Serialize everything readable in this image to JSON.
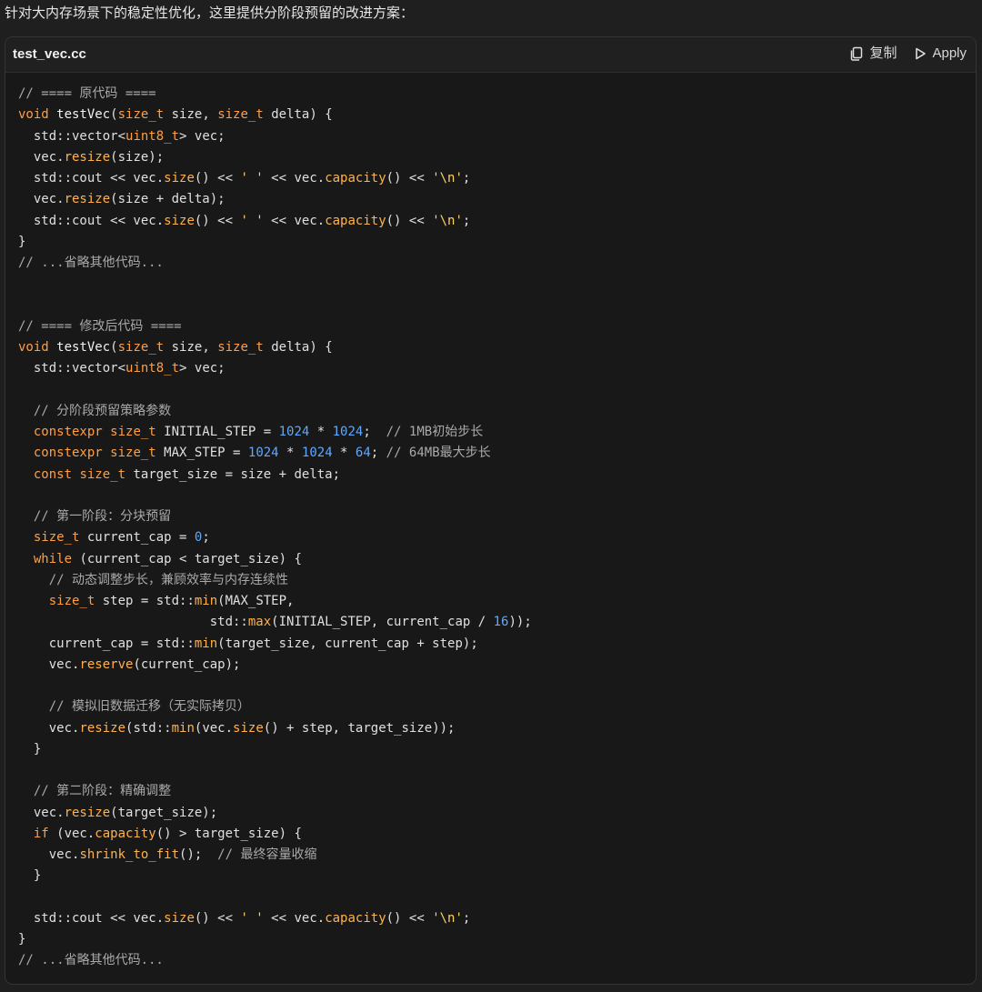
{
  "intro_text": "针对大内存场景下的稳定性优化，这里提供分阶段预留的改进方案：",
  "header": {
    "file_name": "test_vec.cc",
    "copy_label": "复制",
    "apply_label": "Apply"
  },
  "colors": {
    "background": "#1f1f1f",
    "code_background": "#181818",
    "keyword": "#ff9f43",
    "method": "#ffb24d",
    "number": "#5fa8ff",
    "string": "#ffd45c",
    "comment": "#a9a9a9",
    "text": "#e0e0e0"
  },
  "code": {
    "lines": [
      [
        {
          "t": "comment",
          "v": "// ==== 原代码 ===="
        }
      ],
      [
        {
          "t": "keyword",
          "v": "void"
        },
        {
          "t": "plain",
          "v": " "
        },
        {
          "t": "func",
          "v": "testVec"
        },
        {
          "t": "plain",
          "v": "("
        },
        {
          "t": "type",
          "v": "size_t"
        },
        {
          "t": "plain",
          "v": " size, "
        },
        {
          "t": "type",
          "v": "size_t"
        },
        {
          "t": "plain",
          "v": " delta) {"
        }
      ],
      [
        {
          "t": "plain",
          "v": "  std::vector<"
        },
        {
          "t": "type",
          "v": "uint8_t"
        },
        {
          "t": "plain",
          "v": "> vec;"
        }
      ],
      [
        {
          "t": "plain",
          "v": "  vec."
        },
        {
          "t": "method",
          "v": "resize"
        },
        {
          "t": "plain",
          "v": "(size);"
        }
      ],
      [
        {
          "t": "plain",
          "v": "  std::cout << vec."
        },
        {
          "t": "method",
          "v": "size"
        },
        {
          "t": "plain",
          "v": "() << "
        },
        {
          "t": "string",
          "v": "' '"
        },
        {
          "t": "plain",
          "v": " << vec."
        },
        {
          "t": "method",
          "v": "capacity"
        },
        {
          "t": "plain",
          "v": "() << "
        },
        {
          "t": "string",
          "v": "'\\n'"
        },
        {
          "t": "plain",
          "v": ";"
        }
      ],
      [
        {
          "t": "plain",
          "v": "  vec."
        },
        {
          "t": "method",
          "v": "resize"
        },
        {
          "t": "plain",
          "v": "(size + delta);"
        }
      ],
      [
        {
          "t": "plain",
          "v": "  std::cout << vec."
        },
        {
          "t": "method",
          "v": "size"
        },
        {
          "t": "plain",
          "v": "() << "
        },
        {
          "t": "string",
          "v": "' '"
        },
        {
          "t": "plain",
          "v": " << vec."
        },
        {
          "t": "method",
          "v": "capacity"
        },
        {
          "t": "plain",
          "v": "() << "
        },
        {
          "t": "string",
          "v": "'\\n'"
        },
        {
          "t": "plain",
          "v": ";"
        }
      ],
      [
        {
          "t": "plain",
          "v": "}"
        }
      ],
      [
        {
          "t": "comment",
          "v": "// ...省略其他代码..."
        }
      ],
      [],
      [],
      [
        {
          "t": "comment",
          "v": "// ==== 修改后代码 ===="
        }
      ],
      [
        {
          "t": "keyword",
          "v": "void"
        },
        {
          "t": "plain",
          "v": " "
        },
        {
          "t": "func",
          "v": "testVec"
        },
        {
          "t": "plain",
          "v": "("
        },
        {
          "t": "type",
          "v": "size_t"
        },
        {
          "t": "plain",
          "v": " size, "
        },
        {
          "t": "type",
          "v": "size_t"
        },
        {
          "t": "plain",
          "v": " delta) {"
        }
      ],
      [
        {
          "t": "plain",
          "v": "  std::vector<"
        },
        {
          "t": "type",
          "v": "uint8_t"
        },
        {
          "t": "plain",
          "v": "> vec;"
        }
      ],
      [],
      [
        {
          "t": "comment",
          "v": "  // 分阶段预留策略参数"
        }
      ],
      [
        {
          "t": "keyword",
          "v": "  constexpr"
        },
        {
          "t": "plain",
          "v": " "
        },
        {
          "t": "type",
          "v": "size_t"
        },
        {
          "t": "plain",
          "v": " INITIAL_STEP = "
        },
        {
          "t": "number",
          "v": "1024"
        },
        {
          "t": "plain",
          "v": " * "
        },
        {
          "t": "number",
          "v": "1024"
        },
        {
          "t": "plain",
          "v": ";  "
        },
        {
          "t": "comment",
          "v": "// 1MB初始步长"
        }
      ],
      [
        {
          "t": "keyword",
          "v": "  constexpr"
        },
        {
          "t": "plain",
          "v": " "
        },
        {
          "t": "type",
          "v": "size_t"
        },
        {
          "t": "plain",
          "v": " MAX_STEP = "
        },
        {
          "t": "number",
          "v": "1024"
        },
        {
          "t": "plain",
          "v": " * "
        },
        {
          "t": "number",
          "v": "1024"
        },
        {
          "t": "plain",
          "v": " * "
        },
        {
          "t": "number",
          "v": "64"
        },
        {
          "t": "plain",
          "v": "; "
        },
        {
          "t": "comment",
          "v": "// 64MB最大步长"
        }
      ],
      [
        {
          "t": "keyword",
          "v": "  const"
        },
        {
          "t": "plain",
          "v": " "
        },
        {
          "t": "type",
          "v": "size_t"
        },
        {
          "t": "plain",
          "v": " target_size = size + delta;"
        }
      ],
      [],
      [
        {
          "t": "comment",
          "v": "  // 第一阶段：分块预留"
        }
      ],
      [
        {
          "t": "type",
          "v": "  size_t"
        },
        {
          "t": "plain",
          "v": " current_cap = "
        },
        {
          "t": "number",
          "v": "0"
        },
        {
          "t": "plain",
          "v": ";"
        }
      ],
      [
        {
          "t": "keyword",
          "v": "  while"
        },
        {
          "t": "plain",
          "v": " (current_cap < target_size) {"
        }
      ],
      [
        {
          "t": "comment",
          "v": "    // 动态调整步长，兼顾效率与内存连续性"
        }
      ],
      [
        {
          "t": "type",
          "v": "    size_t"
        },
        {
          "t": "plain",
          "v": " step = std::"
        },
        {
          "t": "method",
          "v": "min"
        },
        {
          "t": "plain",
          "v": "(MAX_STEP,"
        }
      ],
      [
        {
          "t": "plain",
          "v": "                         std::"
        },
        {
          "t": "method",
          "v": "max"
        },
        {
          "t": "plain",
          "v": "(INITIAL_STEP, current_cap / "
        },
        {
          "t": "number",
          "v": "16"
        },
        {
          "t": "plain",
          "v": "));"
        }
      ],
      [
        {
          "t": "plain",
          "v": "    current_cap = std::"
        },
        {
          "t": "method",
          "v": "min"
        },
        {
          "t": "plain",
          "v": "(target_size, current_cap + step);"
        }
      ],
      [
        {
          "t": "plain",
          "v": "    vec."
        },
        {
          "t": "method",
          "v": "reserve"
        },
        {
          "t": "plain",
          "v": "(current_cap);"
        }
      ],
      [],
      [
        {
          "t": "comment",
          "v": "    // 模拟旧数据迁移（无实际拷贝）"
        }
      ],
      [
        {
          "t": "plain",
          "v": "    vec."
        },
        {
          "t": "method",
          "v": "resize"
        },
        {
          "t": "plain",
          "v": "(std::"
        },
        {
          "t": "method",
          "v": "min"
        },
        {
          "t": "plain",
          "v": "(vec."
        },
        {
          "t": "method",
          "v": "size"
        },
        {
          "t": "plain",
          "v": "() + step, target_size));"
        }
      ],
      [
        {
          "t": "plain",
          "v": "  }"
        }
      ],
      [],
      [
        {
          "t": "comment",
          "v": "  // 第二阶段：精确调整"
        }
      ],
      [
        {
          "t": "plain",
          "v": "  vec."
        },
        {
          "t": "method",
          "v": "resize"
        },
        {
          "t": "plain",
          "v": "(target_size);"
        }
      ],
      [
        {
          "t": "keyword",
          "v": "  if"
        },
        {
          "t": "plain",
          "v": " (vec."
        },
        {
          "t": "method",
          "v": "capacity"
        },
        {
          "t": "plain",
          "v": "() > target_size) {"
        }
      ],
      [
        {
          "t": "plain",
          "v": "    vec."
        },
        {
          "t": "method",
          "v": "shrink_to_fit"
        },
        {
          "t": "plain",
          "v": "();  "
        },
        {
          "t": "comment",
          "v": "// 最终容量收缩"
        }
      ],
      [
        {
          "t": "plain",
          "v": "  }"
        }
      ],
      [],
      [
        {
          "t": "plain",
          "v": "  std::cout << vec."
        },
        {
          "t": "method",
          "v": "size"
        },
        {
          "t": "plain",
          "v": "() << "
        },
        {
          "t": "string",
          "v": "' '"
        },
        {
          "t": "plain",
          "v": " << vec."
        },
        {
          "t": "method",
          "v": "capacity"
        },
        {
          "t": "plain",
          "v": "() << "
        },
        {
          "t": "string",
          "v": "'\\n'"
        },
        {
          "t": "plain",
          "v": ";"
        }
      ],
      [
        {
          "t": "plain",
          "v": "}"
        }
      ],
      [
        {
          "t": "comment",
          "v": "// ...省略其他代码..."
        }
      ]
    ]
  }
}
